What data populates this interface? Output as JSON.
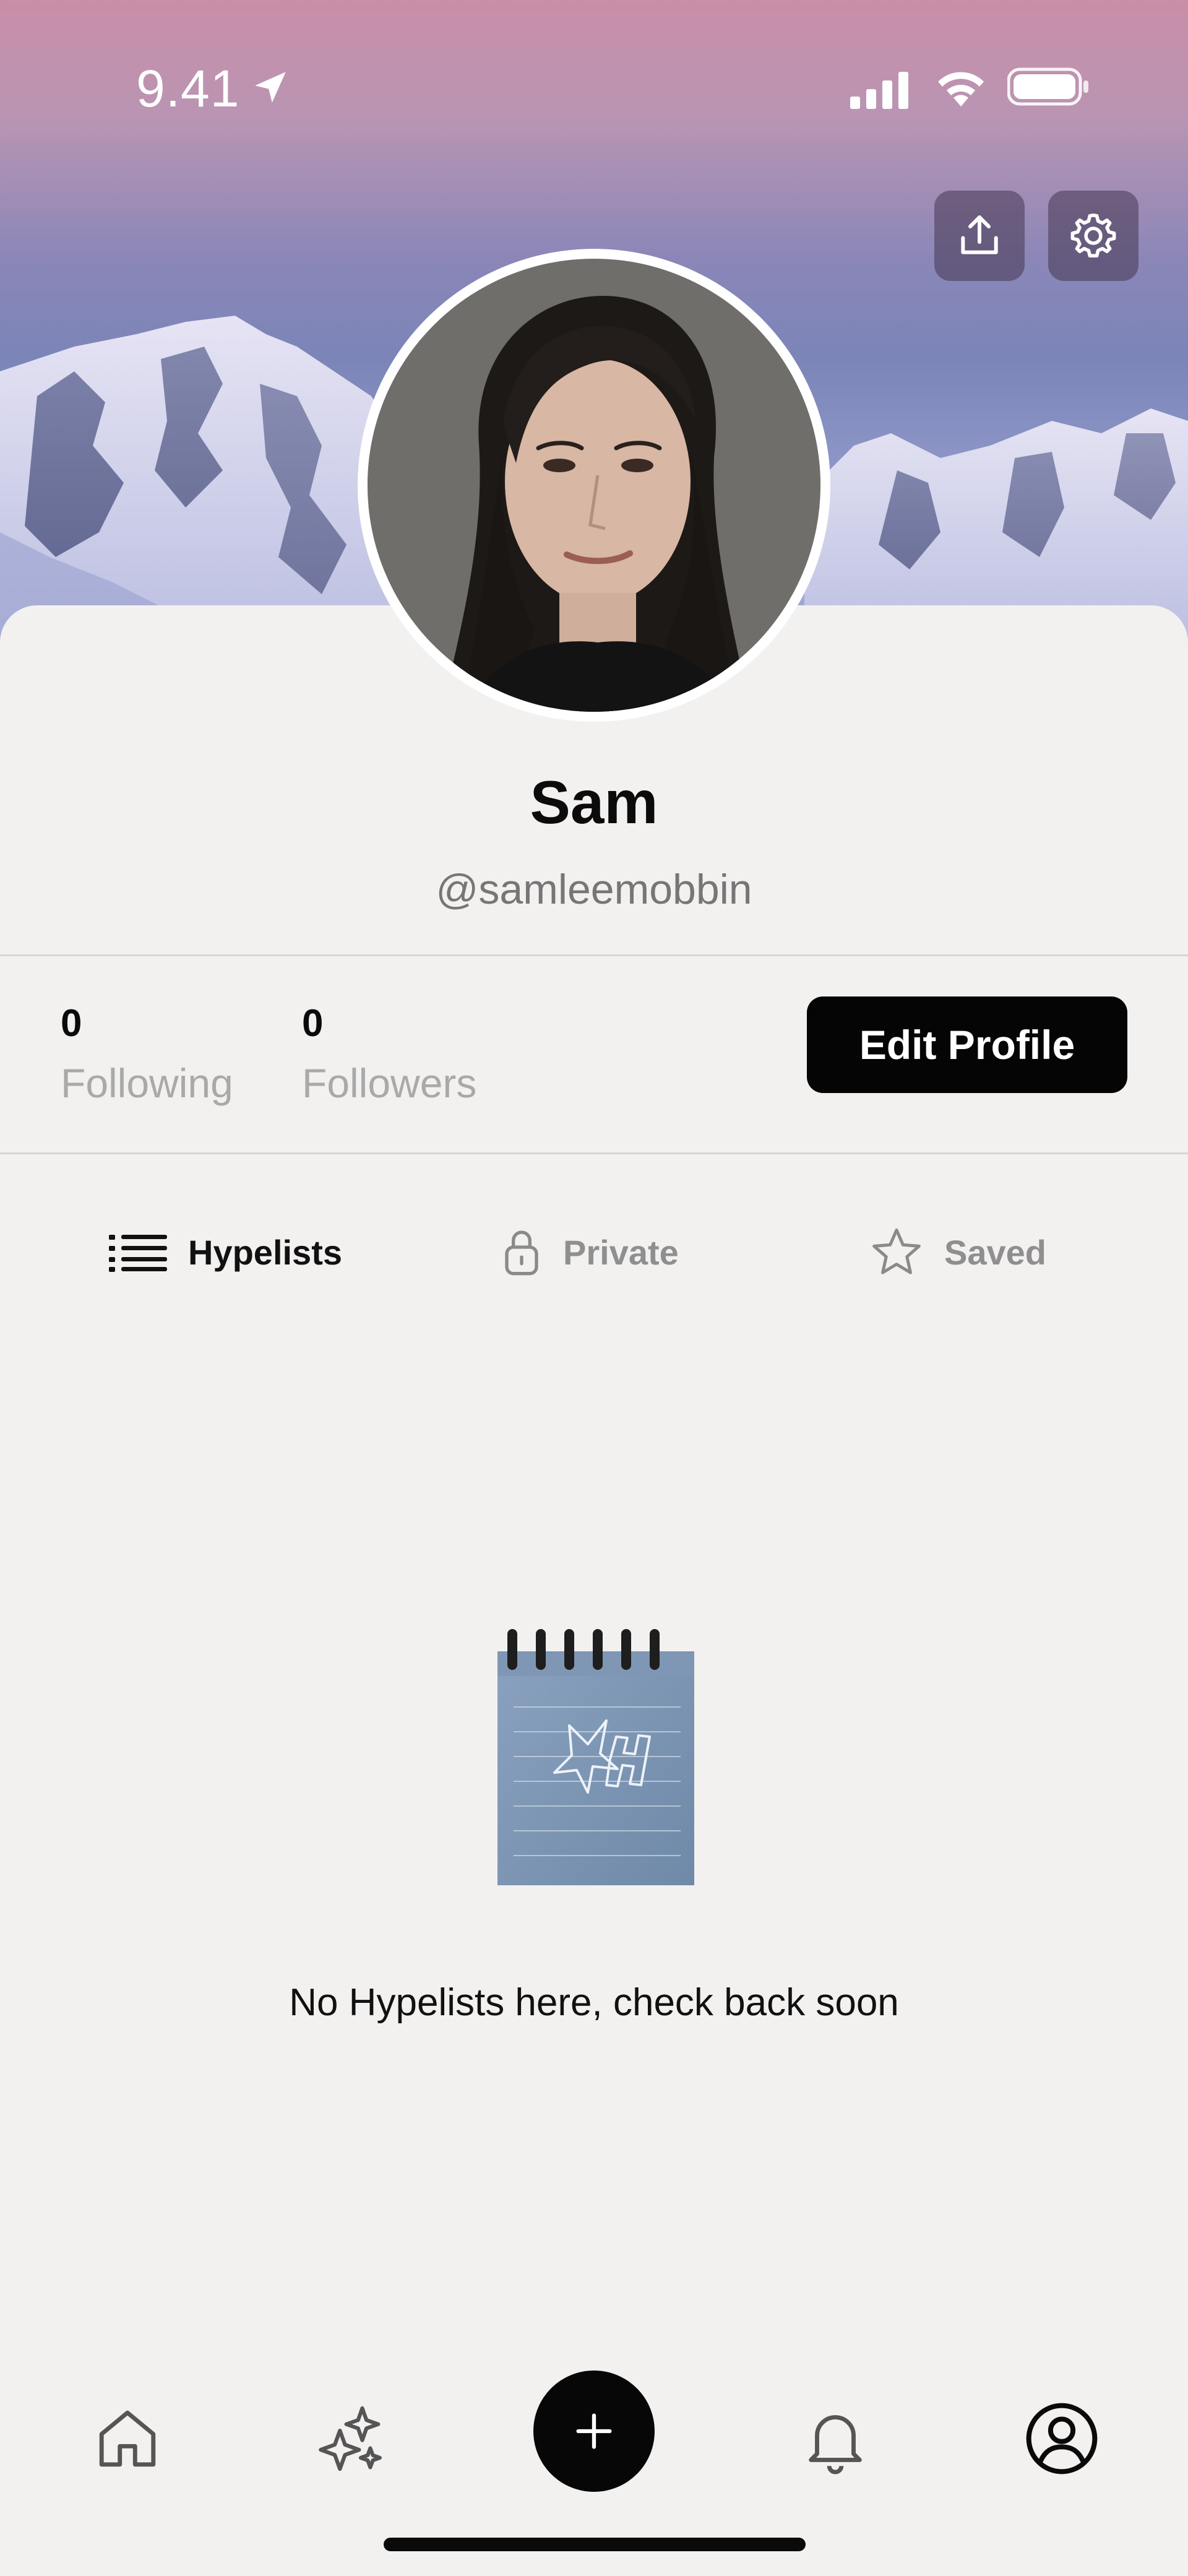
{
  "status_bar": {
    "time": "9.41"
  },
  "header": {
    "share_icon": "share-upload-icon",
    "settings_icon": "gear-icon"
  },
  "profile": {
    "name": "Sam",
    "handle": "@samleemobbin",
    "following_count": "0",
    "following_label": "Following",
    "followers_count": "0",
    "followers_label": "Followers",
    "edit_button": "Edit Profile"
  },
  "tabs": [
    {
      "label": "Hypelists",
      "icon": "list-icon",
      "active": true
    },
    {
      "label": "Private",
      "icon": "lock-icon",
      "active": false
    },
    {
      "label": "Saved",
      "icon": "star-icon",
      "active": false
    }
  ],
  "empty_state": {
    "message": "No Hypelists here, check back soon",
    "illustration": "notepad-illustration"
  },
  "bottom_nav": [
    {
      "name": "home",
      "icon": "home-icon"
    },
    {
      "name": "discover",
      "icon": "sparkles-icon"
    },
    {
      "name": "add",
      "icon": "plus-icon"
    },
    {
      "name": "notifications",
      "icon": "bell-icon"
    },
    {
      "name": "profile",
      "icon": "profile-icon",
      "active": true
    }
  ],
  "colors": {
    "accent": "#050505",
    "background": "#f3f1f0",
    "muted_text": "#a9a9a9"
  }
}
